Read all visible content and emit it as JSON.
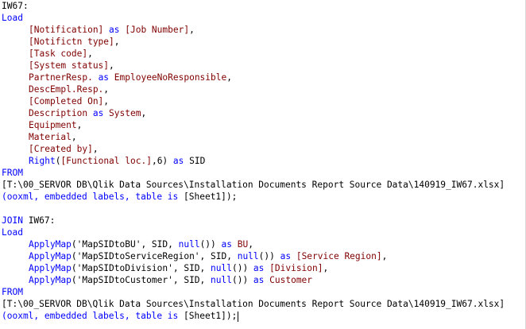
{
  "colors": {
    "keyword": "#0000ff",
    "field": "#800000",
    "plain": "#000000",
    "background": "#ffffff"
  },
  "script_lines": [
    {
      "indent": false,
      "tokens": [
        {
          "t": "IW67:",
          "c": "plain"
        }
      ]
    },
    {
      "indent": false,
      "tokens": [
        {
          "t": "Load",
          "c": "keyword"
        }
      ]
    },
    {
      "indent": true,
      "tokens": [
        {
          "t": "[Notification]",
          "c": "field"
        },
        {
          "t": " as ",
          "c": "keyword"
        },
        {
          "t": "[Job Number]",
          "c": "field"
        },
        {
          "t": ",",
          "c": "plain"
        }
      ]
    },
    {
      "indent": true,
      "tokens": [
        {
          "t": "[Notifictn type]",
          "c": "field"
        },
        {
          "t": ",",
          "c": "plain"
        }
      ]
    },
    {
      "indent": true,
      "tokens": [
        {
          "t": "[Task code]",
          "c": "field"
        },
        {
          "t": ",",
          "c": "plain"
        }
      ]
    },
    {
      "indent": true,
      "tokens": [
        {
          "t": "[System status]",
          "c": "field"
        },
        {
          "t": ",",
          "c": "plain"
        }
      ]
    },
    {
      "indent": true,
      "tokens": [
        {
          "t": "PartnerResp.",
          "c": "field"
        },
        {
          "t": " as ",
          "c": "keyword"
        },
        {
          "t": "EmployeeNoResponsible",
          "c": "field"
        },
        {
          "t": ",",
          "c": "plain"
        }
      ]
    },
    {
      "indent": true,
      "tokens": [
        {
          "t": "DescEmpl.Resp.",
          "c": "field"
        },
        {
          "t": ",",
          "c": "plain"
        }
      ]
    },
    {
      "indent": true,
      "tokens": [
        {
          "t": "[Completed On]",
          "c": "field"
        },
        {
          "t": ",",
          "c": "plain"
        }
      ]
    },
    {
      "indent": true,
      "tokens": [
        {
          "t": "Description",
          "c": "field"
        },
        {
          "t": " as ",
          "c": "keyword"
        },
        {
          "t": "System",
          "c": "field"
        },
        {
          "t": ",",
          "c": "plain"
        }
      ]
    },
    {
      "indent": true,
      "tokens": [
        {
          "t": "Equipment",
          "c": "field"
        },
        {
          "t": ",",
          "c": "plain"
        }
      ]
    },
    {
      "indent": true,
      "tokens": [
        {
          "t": "Material",
          "c": "field"
        },
        {
          "t": ",",
          "c": "plain"
        }
      ]
    },
    {
      "indent": true,
      "tokens": [
        {
          "t": "[Created by]",
          "c": "field"
        },
        {
          "t": ",",
          "c": "plain"
        }
      ]
    },
    {
      "indent": true,
      "tokens": [
        {
          "t": "Right",
          "c": "keyword"
        },
        {
          "t": "(",
          "c": "plain"
        },
        {
          "t": "[Functional loc.]",
          "c": "field"
        },
        {
          "t": ",6)",
          "c": "plain"
        },
        {
          "t": " as ",
          "c": "keyword"
        },
        {
          "t": "SID",
          "c": "plain"
        }
      ]
    },
    {
      "indent": false,
      "tokens": [
        {
          "t": "FROM",
          "c": "keyword"
        }
      ]
    },
    {
      "indent": false,
      "tokens": [
        {
          "t": "[T:\\00_SERVOR DB\\Qlik Data Sources\\Installation Documents Report Source Data\\140919_IW67.xlsx]",
          "c": "plain"
        }
      ]
    },
    {
      "indent": false,
      "tokens": [
        {
          "t": "(ooxml, embedded labels, table is ",
          "c": "keyword"
        },
        {
          "t": "[Sheet1]",
          "c": "plain"
        },
        {
          "t": ");",
          "c": "plain"
        }
      ]
    },
    {
      "indent": false,
      "tokens": [
        {
          "t": "",
          "c": "plain"
        }
      ]
    },
    {
      "indent": false,
      "tokens": [
        {
          "t": "JOIN",
          "c": "keyword"
        },
        {
          "t": " IW67:",
          "c": "plain"
        }
      ]
    },
    {
      "indent": false,
      "tokens": [
        {
          "t": "Load",
          "c": "keyword"
        }
      ]
    },
    {
      "indent": true,
      "tokens": [
        {
          "t": "ApplyMap",
          "c": "keyword"
        },
        {
          "t": "('MapSIDtoBU', SID, ",
          "c": "plain"
        },
        {
          "t": "null",
          "c": "keyword"
        },
        {
          "t": "())",
          "c": "plain"
        },
        {
          "t": " as ",
          "c": "keyword"
        },
        {
          "t": "BU",
          "c": "field"
        },
        {
          "t": ",",
          "c": "plain"
        }
      ]
    },
    {
      "indent": true,
      "tokens": [
        {
          "t": "ApplyMap",
          "c": "keyword"
        },
        {
          "t": "('MapSIDtoServiceRegion', SID, ",
          "c": "plain"
        },
        {
          "t": "null",
          "c": "keyword"
        },
        {
          "t": "())",
          "c": "plain"
        },
        {
          "t": " as ",
          "c": "keyword"
        },
        {
          "t": "[Service Region]",
          "c": "field"
        },
        {
          "t": ",",
          "c": "plain"
        }
      ]
    },
    {
      "indent": true,
      "tokens": [
        {
          "t": "ApplyMap",
          "c": "keyword"
        },
        {
          "t": "('MapSIDtoDivision', SID, ",
          "c": "plain"
        },
        {
          "t": "null",
          "c": "keyword"
        },
        {
          "t": "())",
          "c": "plain"
        },
        {
          "t": " as ",
          "c": "keyword"
        },
        {
          "t": "[Division]",
          "c": "field"
        },
        {
          "t": ",",
          "c": "plain"
        }
      ]
    },
    {
      "indent": true,
      "tokens": [
        {
          "t": "ApplyMap",
          "c": "keyword"
        },
        {
          "t": "('MapSIDtoCustomer', SID, ",
          "c": "plain"
        },
        {
          "t": "null",
          "c": "keyword"
        },
        {
          "t": "())",
          "c": "plain"
        },
        {
          "t": " as ",
          "c": "keyword"
        },
        {
          "t": "Customer",
          "c": "field"
        }
      ]
    },
    {
      "indent": false,
      "tokens": [
        {
          "t": "FROM",
          "c": "keyword"
        }
      ]
    },
    {
      "indent": false,
      "tokens": [
        {
          "t": "[T:\\00_SERVOR DB\\Qlik Data Sources\\Installation Documents Report Source Data\\140919_IW67.xlsx]",
          "c": "plain"
        }
      ]
    },
    {
      "indent": false,
      "caret": true,
      "tokens": [
        {
          "t": "(ooxml, embedded labels, table is ",
          "c": "keyword"
        },
        {
          "t": "[Sheet1]",
          "c": "plain"
        },
        {
          "t": ");",
          "c": "plain"
        }
      ]
    }
  ]
}
